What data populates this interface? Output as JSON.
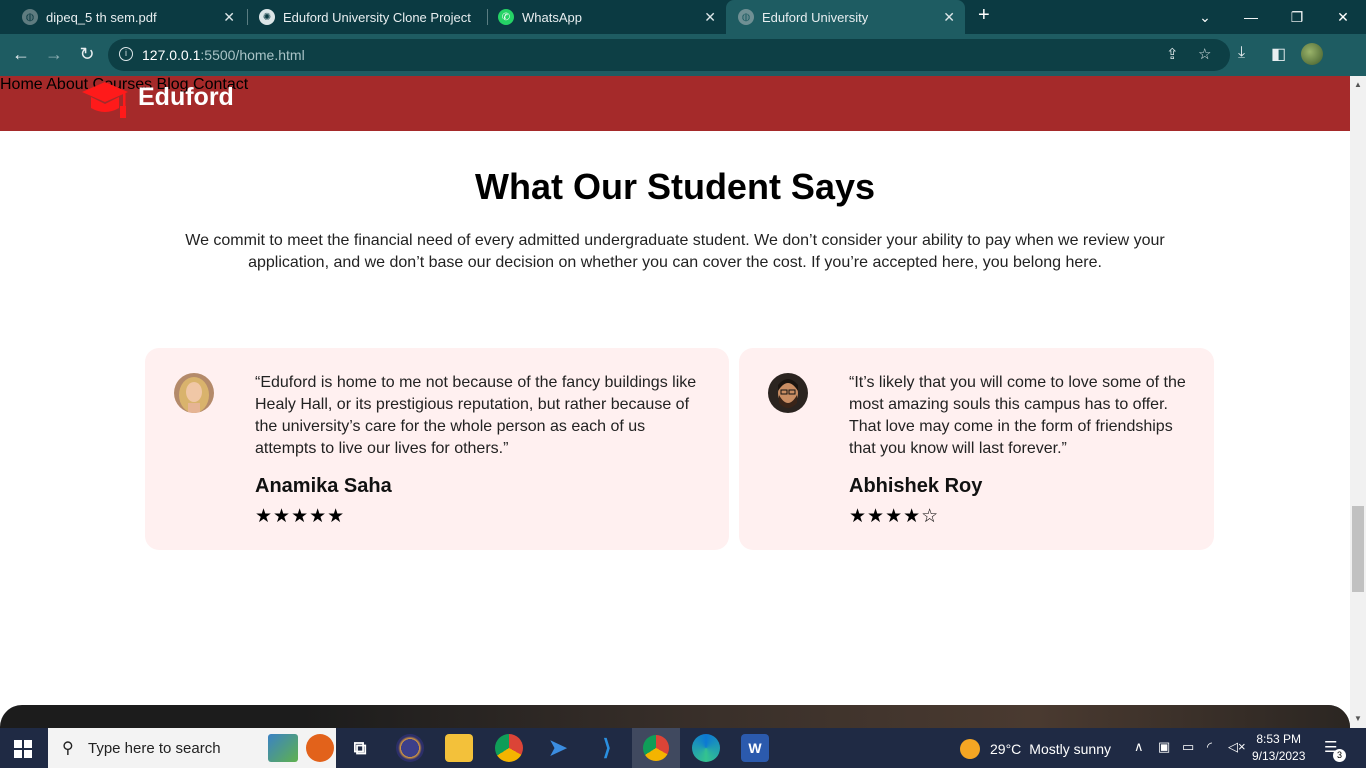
{
  "browser": {
    "tabs": [
      {
        "title": "dipeq_5 th sem.pdf",
        "icon": "globe-icon"
      },
      {
        "title": "Eduford University Clone Project",
        "icon": "chatgpt-icon"
      },
      {
        "title": "WhatsApp",
        "icon": "whatsapp-icon"
      },
      {
        "title": "Eduford University",
        "icon": "globe-icon",
        "active": true
      }
    ],
    "new_tab": "+",
    "url_host": "127.0.0.1",
    "url_path": ":5500/home.html",
    "window_controls": {
      "minimize": "—",
      "maximize": "❐",
      "close": "✕",
      "tab_search": "⌄"
    }
  },
  "site": {
    "brand": "Eduford",
    "nav": [
      "Home",
      "About",
      "Courses",
      "Blog",
      "Contact"
    ],
    "header_color": "#a52a2a"
  },
  "section": {
    "title": "What Our Student Says",
    "description": "We commit to meet the financial need of every admitted undergraduate student. We don’t consider your ability to pay when we review your application, and we don’t base our decision on whether you can cover the cost. If you’re accepted here, you belong here."
  },
  "testimonials": [
    {
      "quote_lines": [
        "“Eduford is home to me not because of the fancy buildings like",
        "Healy Hall, or its prestigious reputation, but rather because of",
        "the university’s care for the whole person as each of us",
        "attempts to live our lives for others.”"
      ],
      "name": "Anamika Saha",
      "stars": "★★★★★",
      "rating": 5
    },
    {
      "quote_lines": [
        "“It’s likely that you will come to love some of the",
        "most amazing souls this campus has to offer.",
        "That love may come in the form of friendships",
        "that you know will last forever.”"
      ],
      "name": "Abhishek Roy",
      "stars": "★★★★☆",
      "rating": 4
    }
  ],
  "taskbar": {
    "search_placeholder": "Type here to search",
    "weather_temp": "29°C",
    "weather_text": "Mostly sunny",
    "time": "8:53 PM",
    "date": "9/13/2023",
    "notifications": "3"
  }
}
